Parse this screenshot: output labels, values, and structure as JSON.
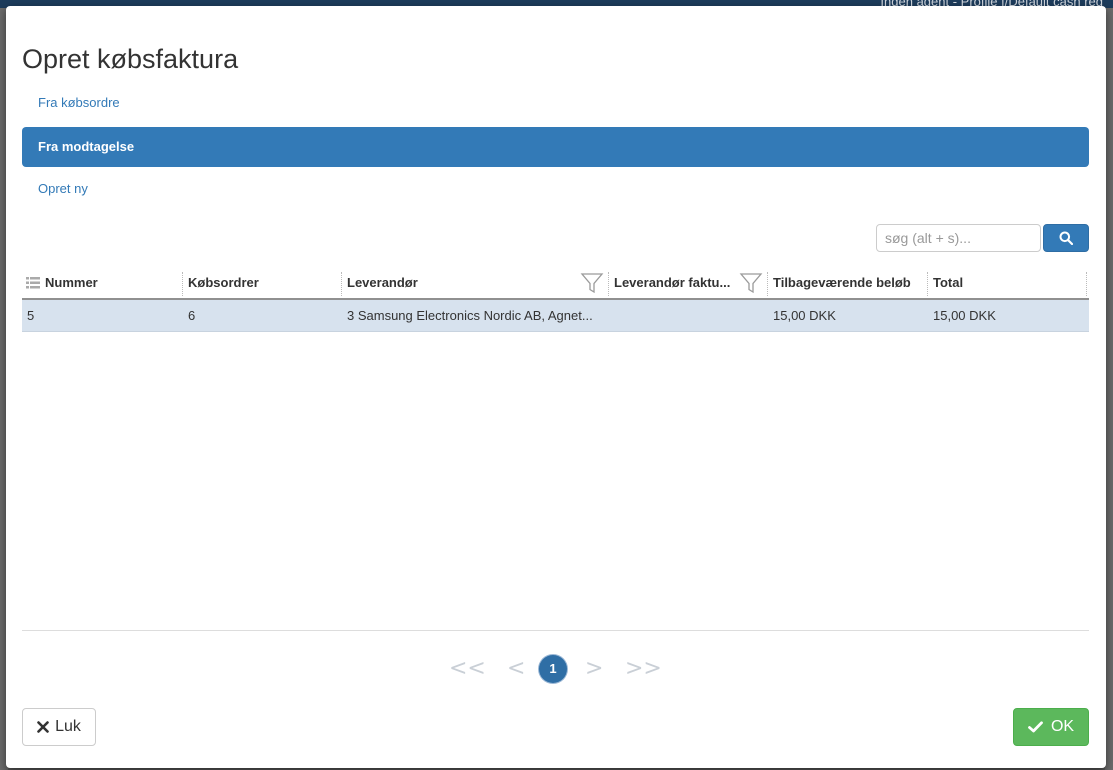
{
  "background": {
    "topbar_text": "Ingen agent - Profile f/Default cash reg"
  },
  "modal": {
    "title": "Opret købsfaktura",
    "nav": [
      {
        "label": "Fra købsordre",
        "active": false
      },
      {
        "label": "Fra modtagelse",
        "active": true
      },
      {
        "label": "Opret ny",
        "active": false
      }
    ],
    "search": {
      "placeholder": "søg (alt + s)...",
      "value": ""
    }
  },
  "grid": {
    "columns": [
      "Nummer",
      "Købsordrer",
      "Leverandør",
      "Leverandør faktu...",
      "Tilbageværende beløb",
      "Total"
    ],
    "rows": [
      {
        "nummer": "5",
        "koebsordrer": "6",
        "leverandoer": "3 Samsung Electronics Nordic AB, Agnet...",
        "leverandoer_faktura": "",
        "tilbagevaerende": "15,00 DKK",
        "total": "15,00 DKK"
      }
    ]
  },
  "pager": {
    "first": "<<",
    "prev": "<",
    "current": "1",
    "next": ">",
    "last": ">>"
  },
  "footer": {
    "close_label": "Luk",
    "ok_label": "OK"
  },
  "colors": {
    "primary": "#337ab7",
    "success": "#5cb85c",
    "row_selected": "#d7e2ee"
  },
  "icons": {
    "search": "search-icon",
    "filter": "filter-icon",
    "columns": "column-list-icon",
    "close": "times-icon",
    "ok": "check-icon"
  }
}
